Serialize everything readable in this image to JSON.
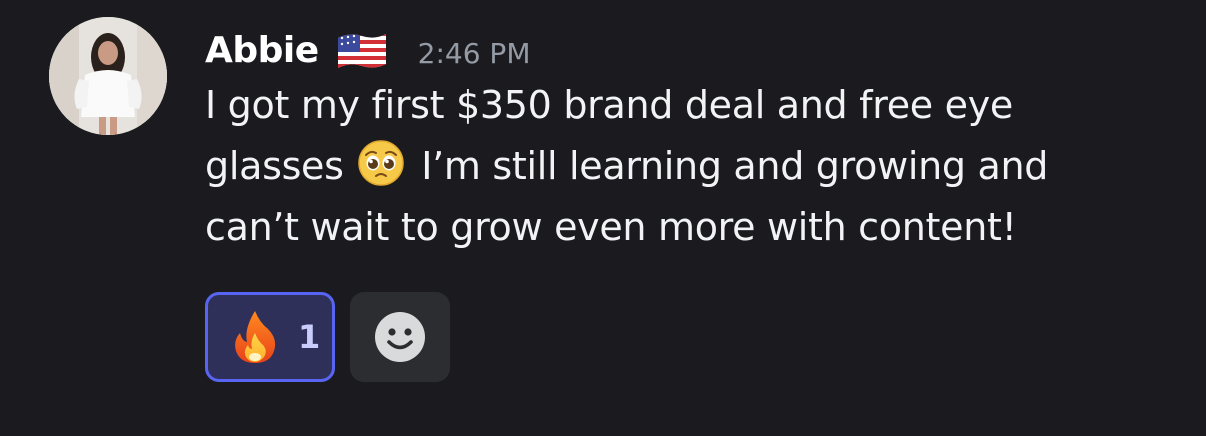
{
  "message": {
    "author": "Abbie",
    "author_badge_icon": "us-flag-icon",
    "timestamp": "2:46 PM",
    "content_lines": [
      {
        "before": "I got my first $350 brand deal and free eye",
        "after": ""
      },
      {
        "before": "glasses ",
        "emoji": "pleading-face-icon",
        "after": " I’m still learning and growing and"
      },
      {
        "before": "can’t wait to grow even more with content!",
        "after": ""
      }
    ],
    "reactions": [
      {
        "emoji": "fire-icon",
        "count": "1",
        "active": true
      }
    ],
    "add_reaction_icon": "smiley-icon"
  },
  "colors": {
    "background": "#1b1b1f",
    "reaction_active_border": "#5865f2",
    "reaction_active_bg": "#2e305a",
    "timestamp": "#949ba4"
  }
}
